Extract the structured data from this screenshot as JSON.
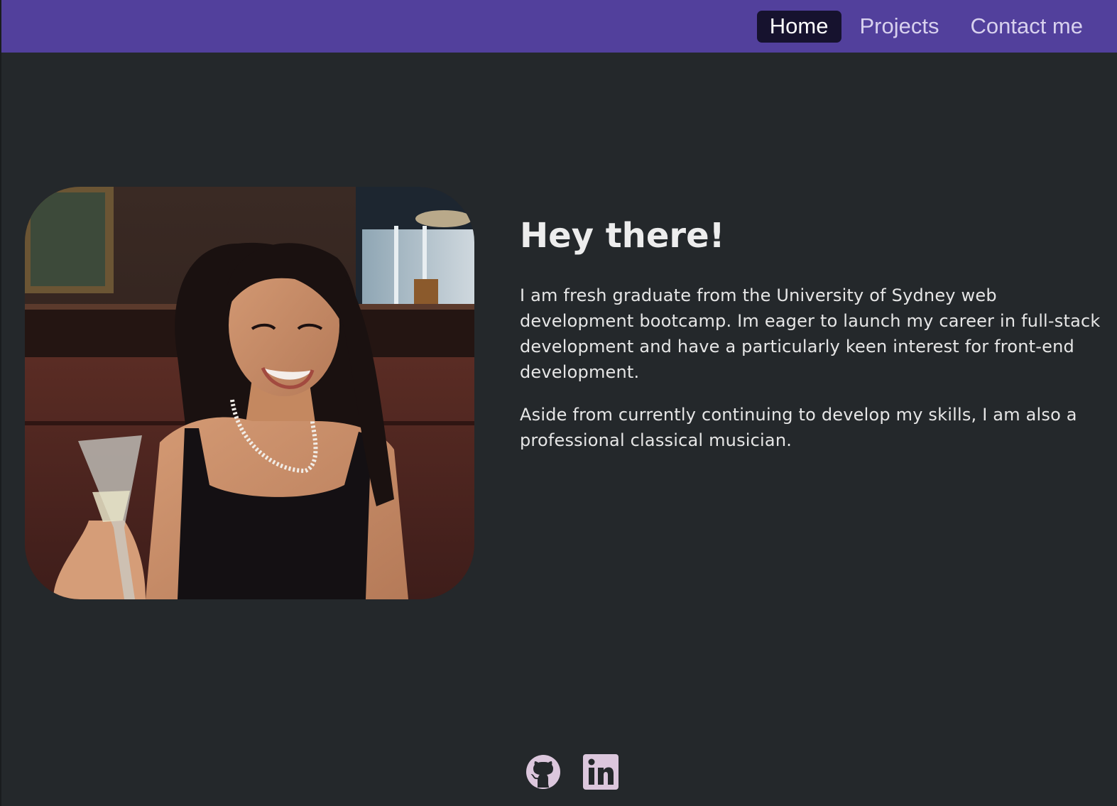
{
  "nav": {
    "items": [
      {
        "label": "Home",
        "active": true
      },
      {
        "label": "Projects",
        "active": false
      },
      {
        "label": "Contact me",
        "active": false
      }
    ]
  },
  "hero": {
    "heading": "Hey there!",
    "paragraphs": [
      "I am fresh graduate from the University of Sydney web development bootcamp. Im eager to launch my career in full-stack development and have a particularly keen interest for front-end development.",
      "Aside from currently continuing to develop my skills, I am also a professional classical musician."
    ]
  },
  "socials": [
    {
      "icon": "github-icon"
    },
    {
      "icon": "linkedin-icon"
    }
  ],
  "colors": {
    "navbar": "#52409c",
    "nav_active_bg": "#16122e",
    "page_bg": "#24282b",
    "icon_fill": "#dcc7dd"
  }
}
